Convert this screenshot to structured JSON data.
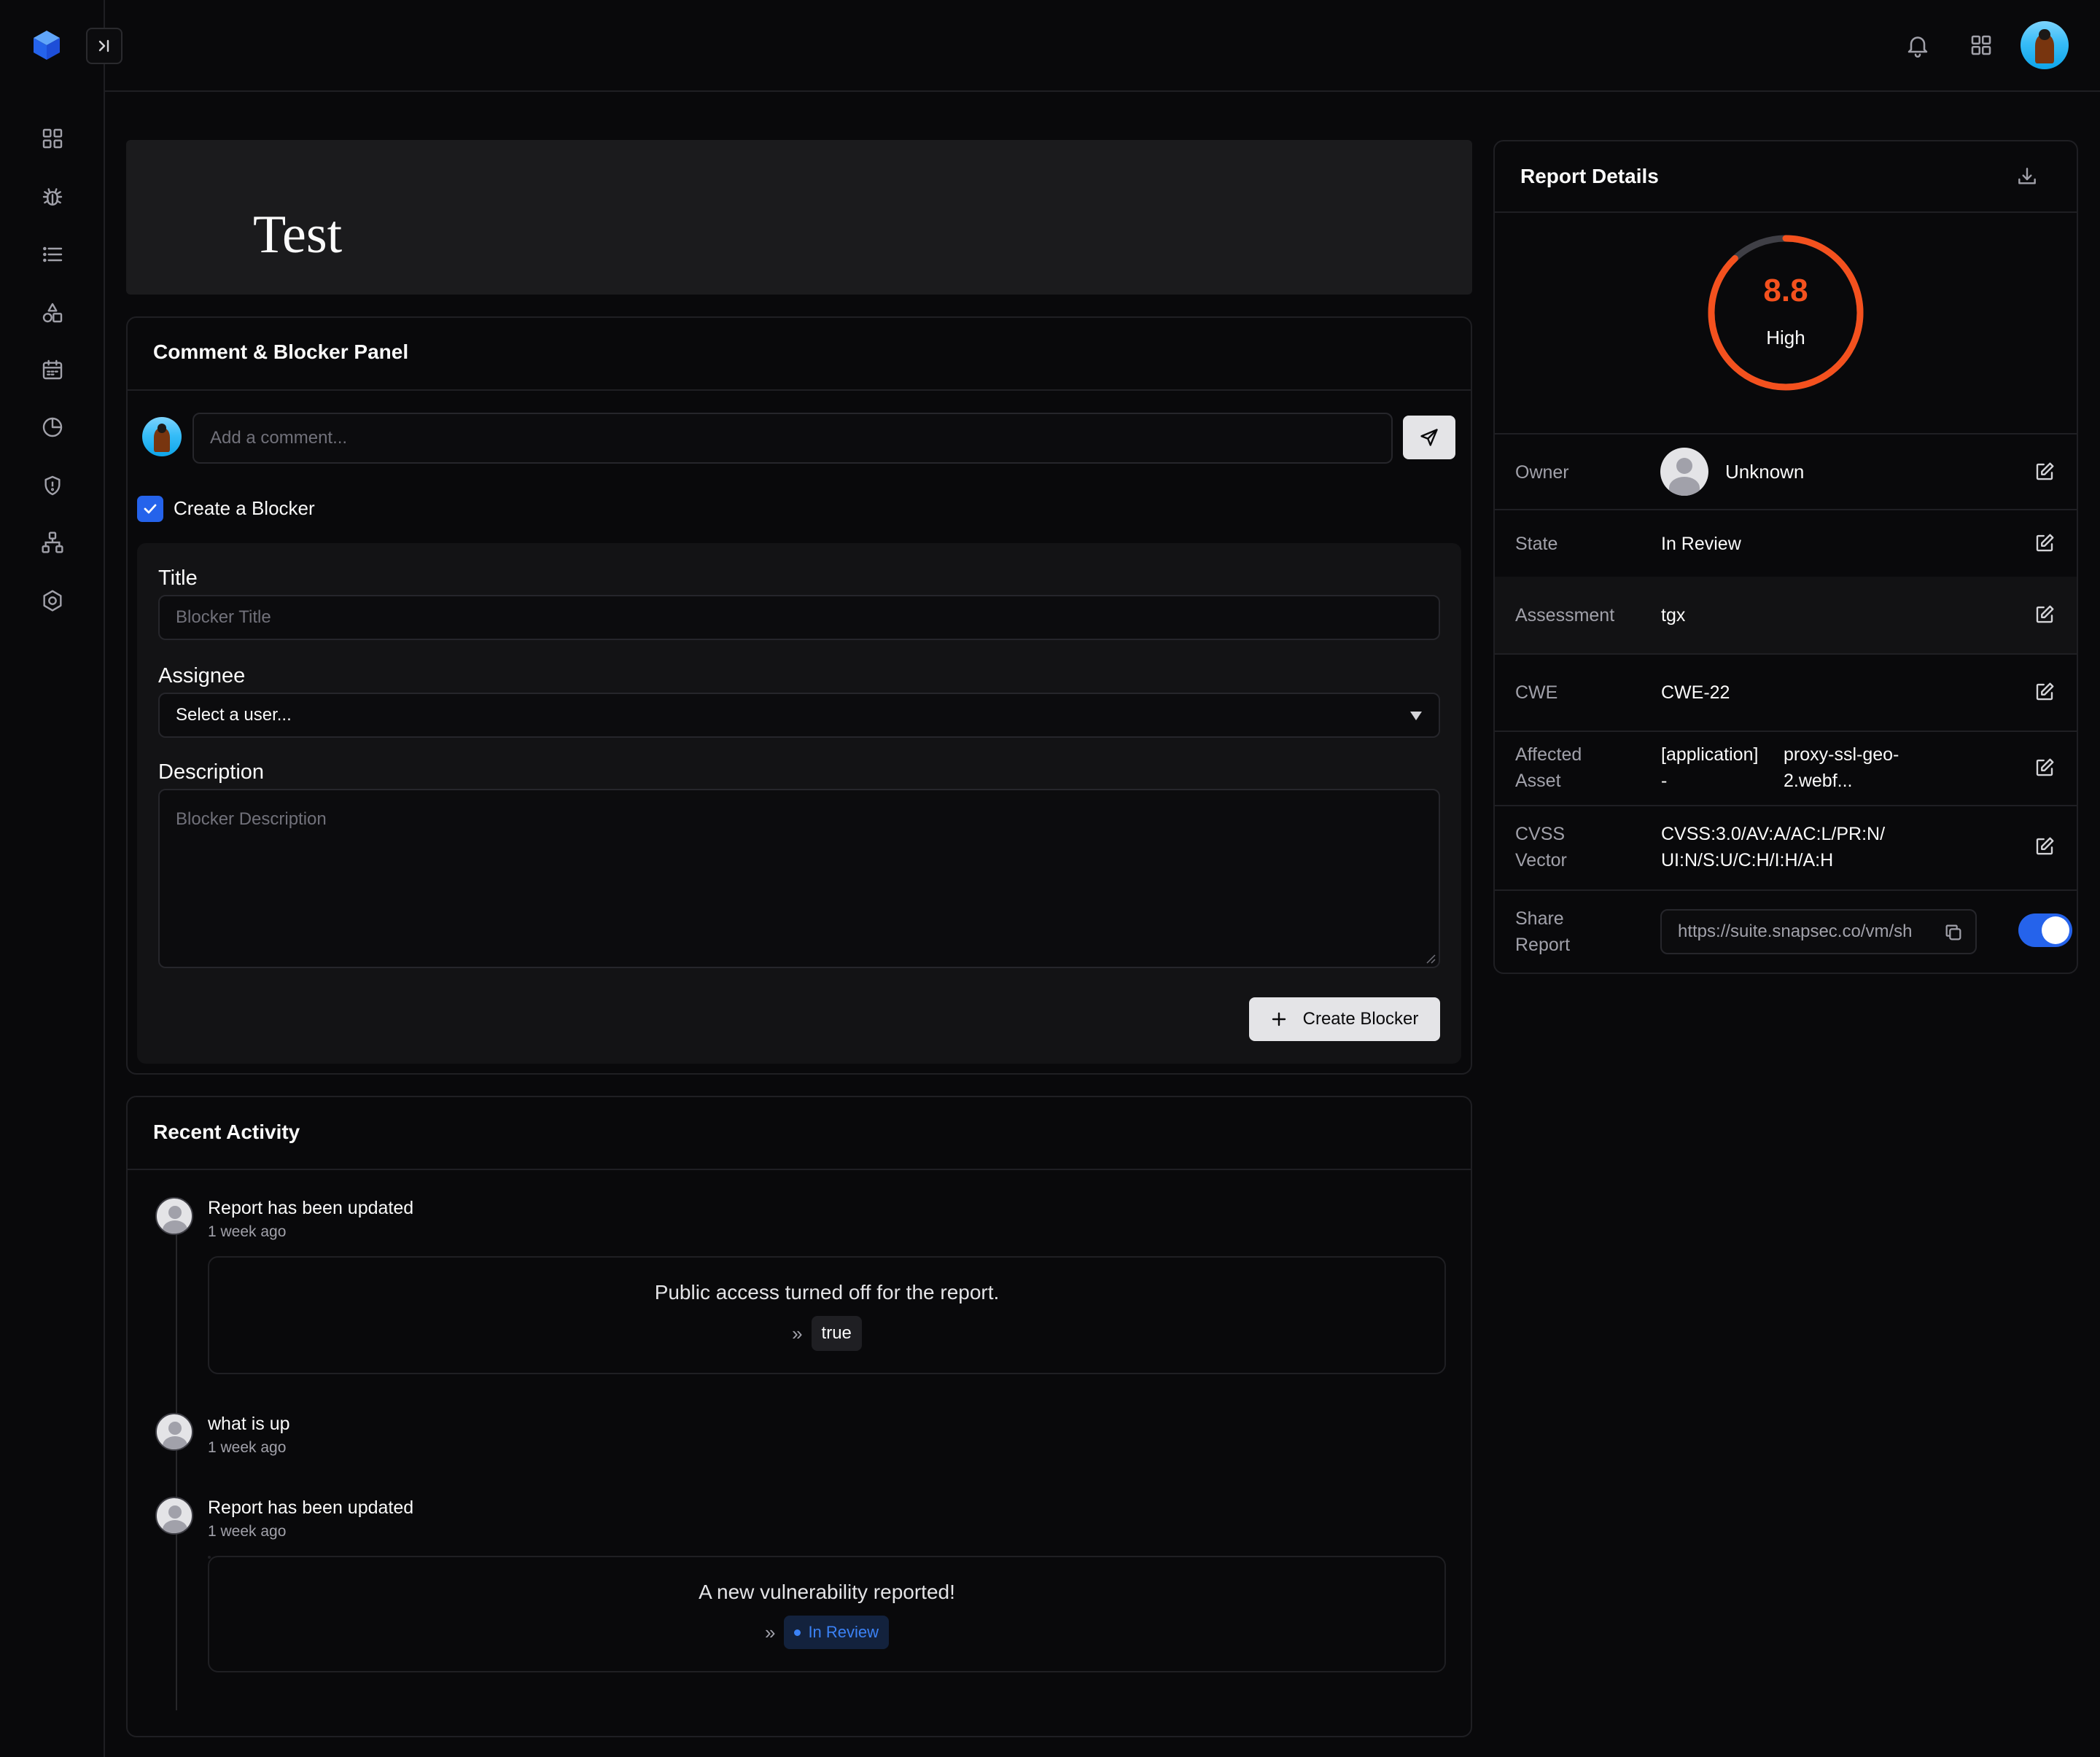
{
  "page": {
    "title": "Test"
  },
  "sidebar": {
    "collapse_icon": "panel-expand-icon",
    "items": [
      {
        "name": "dashboard-icon"
      },
      {
        "name": "bug-icon"
      },
      {
        "name": "list-icon"
      },
      {
        "name": "shapes-icon"
      },
      {
        "name": "calendar-icon"
      },
      {
        "name": "pie-chart-icon"
      },
      {
        "name": "shield-icon"
      },
      {
        "name": "network-icon"
      },
      {
        "name": "settings-icon"
      }
    ]
  },
  "topbar": {
    "icons": [
      "bell-icon",
      "apps-grid-icon",
      "user-avatar"
    ]
  },
  "comment_panel": {
    "title": "Comment & Blocker Panel",
    "comment_placeholder": "Add a comment...",
    "create_blocker_label": "Create a Blocker",
    "create_blocker_checked": true,
    "blocker_form": {
      "title_label": "Title",
      "title_placeholder": "Blocker Title",
      "assignee_label": "Assignee",
      "assignee_value": "Select a user...",
      "description_label": "Description",
      "description_placeholder": "Blocker Description",
      "submit_label": "Create Blocker"
    }
  },
  "recent_activity": {
    "title": "Recent Activity",
    "items": [
      {
        "title": "Report has been updated",
        "time": "1 week ago",
        "message": "Public access turned off for the report.",
        "value": "true"
      },
      {
        "title": "what is up",
        "time": "1 week ago"
      },
      {
        "title": "Report has been updated",
        "time": "1 week ago",
        "message": "A new vulnerability reported!",
        "value": "In Review"
      }
    ]
  },
  "report_details": {
    "title": "Report Details",
    "score": "8.8",
    "score_fraction": 0.88,
    "severity": "High",
    "colors": {
      "severity": "#f4511e",
      "track": "#3f3f46",
      "accent": "#2563eb"
    },
    "rows": {
      "owner": {
        "label": "Owner",
        "value": "Unknown"
      },
      "state": {
        "label": "State",
        "value": "In Review"
      },
      "assessment": {
        "label": "Assessment",
        "value": "tgx"
      },
      "cwe": {
        "label": "CWE",
        "value": "CWE-22"
      },
      "affected_asset": {
        "label_1": "Affected",
        "label_2": "Asset",
        "value_a1": "[application]",
        "value_a2": "-",
        "value_b1": "proxy-ssl-geo-",
        "value_b2": "2.webf..."
      },
      "cvss": {
        "label_1": "CVSS",
        "label_2": "Vector",
        "value_1": "CVSS:3.0/AV:A/AC:L/PR:N/",
        "value_2": "UI:N/S:U/C:H/I:H/A:H"
      },
      "share": {
        "label_1": "Share",
        "label_2": "Report",
        "url": "https://suite.snapsec.co/vm/sh",
        "enabled": true
      }
    }
  }
}
